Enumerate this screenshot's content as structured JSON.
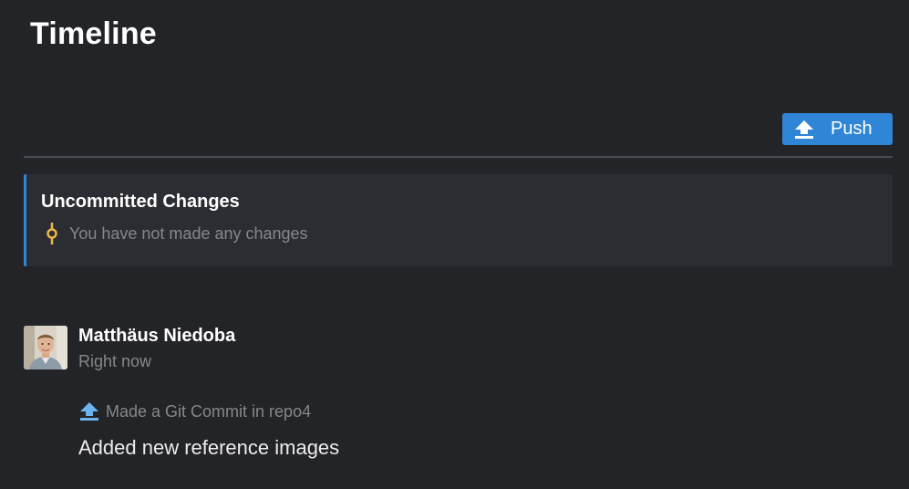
{
  "page": {
    "title": "Timeline"
  },
  "toolbar": {
    "push_label": "Push",
    "push_icon": "upload-icon",
    "accent_color": "#2f86d6"
  },
  "uncommitted": {
    "heading": "Uncommitted Changes",
    "status": "You have not made any changes",
    "icon": "git-commit-icon",
    "icon_color": "#e8b64a"
  },
  "timeline": {
    "entries": [
      {
        "author": "Matthäus Niedoba",
        "time": "Right now",
        "activity": "Made a Git Commit in repo4",
        "activity_icon": "upload-icon",
        "message": "Added new reference images"
      }
    ]
  }
}
